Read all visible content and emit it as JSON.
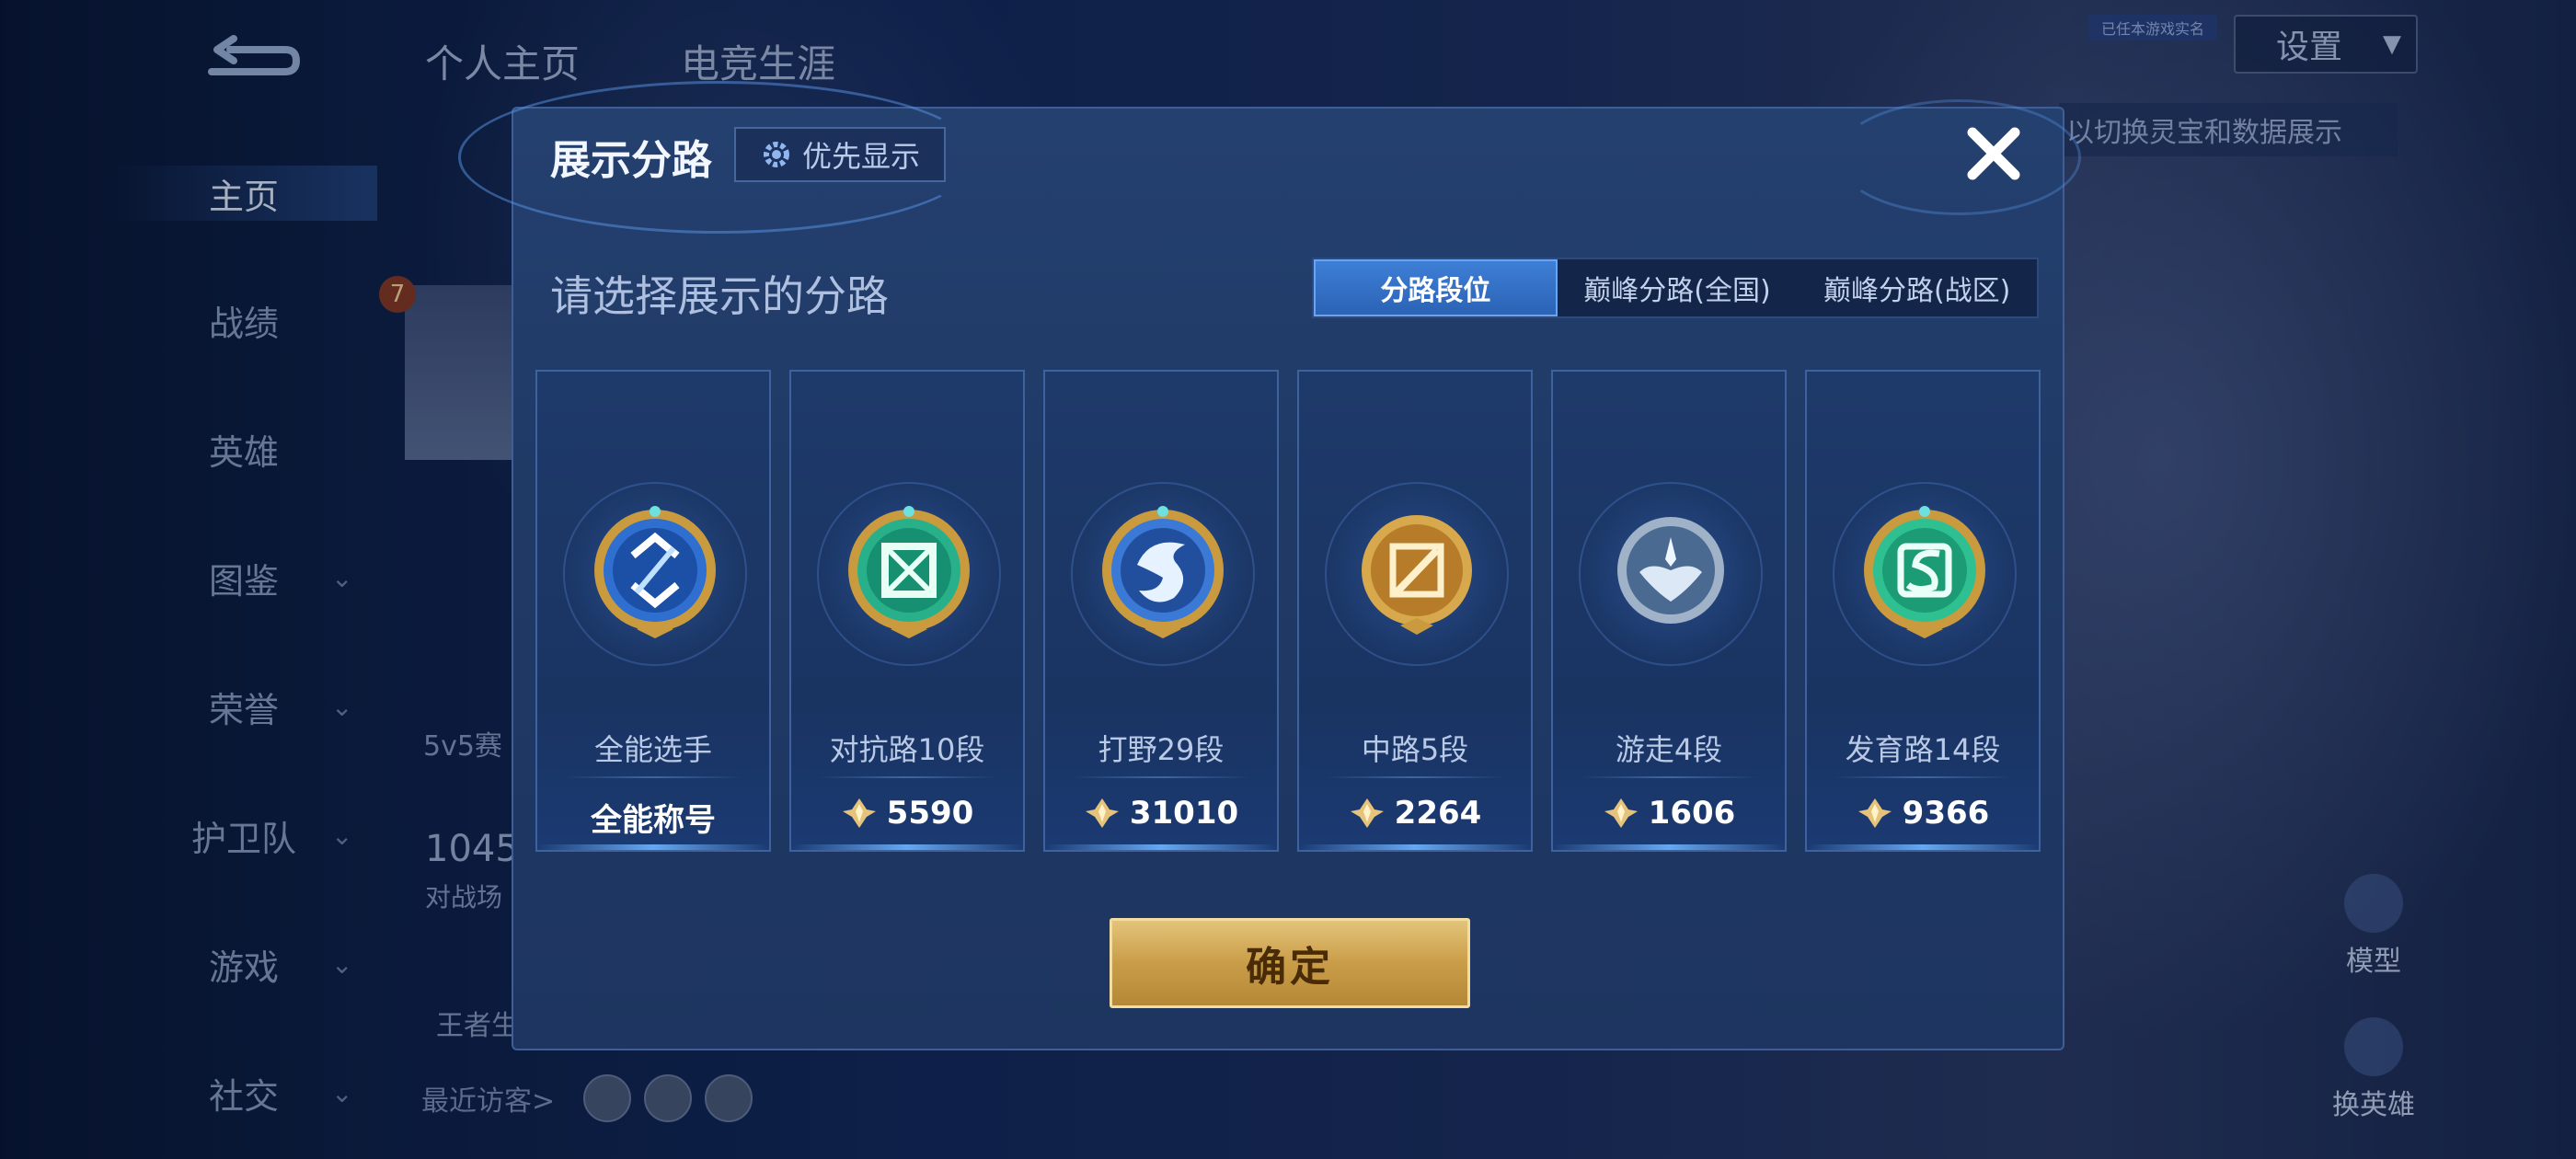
{
  "sidebar": {
    "items": [
      {
        "label": "主页",
        "chevron": false
      },
      {
        "label": "战绩",
        "chevron": false
      },
      {
        "label": "英雄",
        "chevron": false
      },
      {
        "label": "图鉴",
        "chevron": true
      },
      {
        "label": "荣誉",
        "chevron": true
      },
      {
        "label": "护卫队",
        "chevron": true
      },
      {
        "label": "游戏",
        "chevron": true
      },
      {
        "label": "社交",
        "chevron": true
      }
    ]
  },
  "background": {
    "tabs": [
      "个人主页",
      "电竞生涯"
    ],
    "settings_label": "设置",
    "tiny_badge": "已任本游戏实名",
    "right_hint": "以切换灵宝和数据展示",
    "mode_text": "5v5赛",
    "number_text": "1045",
    "sub_text": "对战场",
    "king_text": "王者生",
    "visitors_label": "最近访客>",
    "level_badge": "7",
    "model_label": "模型",
    "swap_hero_label": "换英雄"
  },
  "dialog": {
    "title": "展示分路",
    "priority_label": "优先显示",
    "subtitle": "请选择展示的分路",
    "segments": [
      "分路段位",
      "巅峰分路(全国)",
      "巅峰分路(战区)"
    ],
    "active_segment": 0,
    "cards": [
      {
        "label": "全能选手",
        "value": "全能称号",
        "has_icon": false,
        "badge": "allround"
      },
      {
        "label": "对抗路10段",
        "value": "5590",
        "has_icon": true,
        "badge": "clash"
      },
      {
        "label": "打野29段",
        "value": "31010",
        "has_icon": true,
        "badge": "jungle"
      },
      {
        "label": "中路5段",
        "value": "2264",
        "has_icon": true,
        "badge": "mid"
      },
      {
        "label": "游走4段",
        "value": "1606",
        "has_icon": true,
        "badge": "roam"
      },
      {
        "label": "发育路14段",
        "value": "9366",
        "has_icon": true,
        "badge": "farm"
      }
    ],
    "confirm_label": "确定"
  },
  "colors": {
    "accent_blue": "#2b63b5",
    "gold": "#c99d48",
    "panel": "#203a66"
  }
}
